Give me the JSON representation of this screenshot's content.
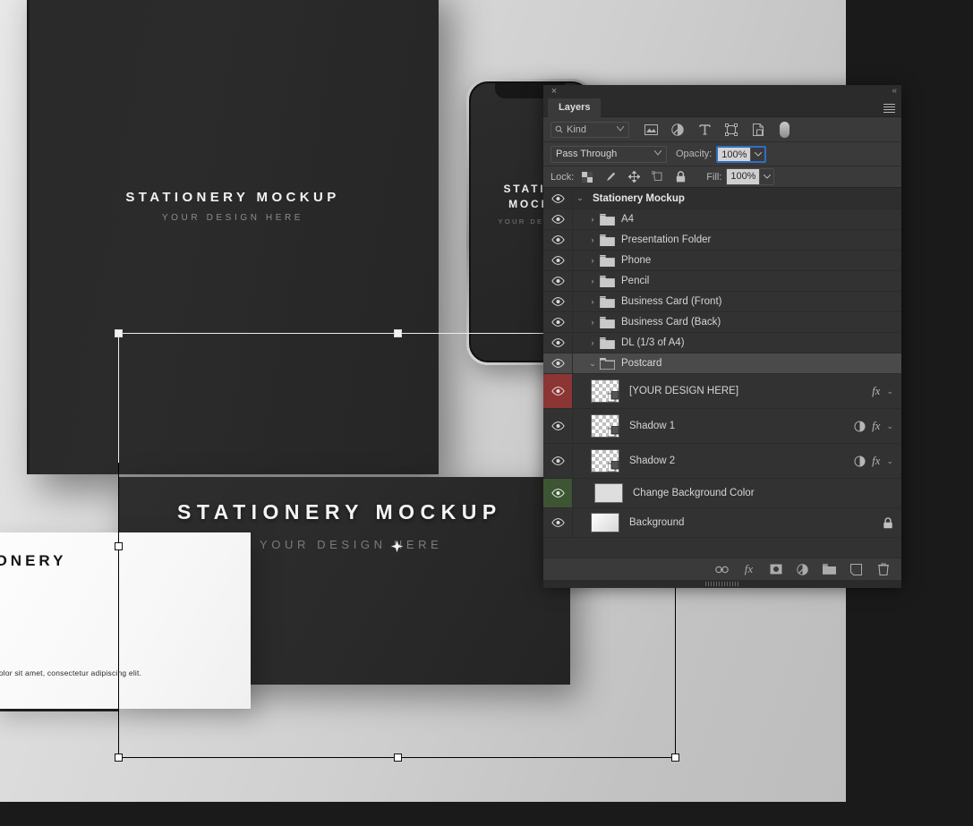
{
  "app": {
    "background_color": "#1a1a1a",
    "canvas_color": "#cfcfcf"
  },
  "canvas": {
    "a4": {
      "title": "STATIONERY MOCKUP",
      "subtitle": "YOUR DESIGN HERE"
    },
    "phone": {
      "title_line1": "STATIO",
      "title_line2": "MOCK",
      "subtitle": "YOUR DESIG"
    },
    "wide_card": {
      "title": "STATIONERY MOCKUP",
      "subtitle": "YOUR DESIGN HERE"
    },
    "white_card": {
      "title": "STATIONERY",
      "body": "Lorem ipsum dolor sit amet, consectetur adipiscing elit."
    },
    "cursor": "move-tool-cursor"
  },
  "panel": {
    "close_label": "×",
    "collapse_label": "«",
    "tab_label": "Layers",
    "menu_icon": "panel-menu-icon",
    "filter": {
      "kind_label": "Kind",
      "search_icon": "search-icon",
      "caret": "⌄",
      "icons": [
        "pixel-layer-filter-icon",
        "adjustment-layer-filter-icon",
        "type-layer-filter-icon",
        "shape-layer-filter-icon",
        "smart-object-filter-icon"
      ],
      "toggle": "filter-enable-toggle"
    },
    "blend": {
      "mode": "Pass Through",
      "opacity_label": "Opacity:",
      "opacity_value": "100%",
      "caret": "⌄"
    },
    "lock": {
      "label": "Lock:",
      "icons": [
        "lock-transparent-pixels-icon",
        "lock-image-pixels-icon",
        "lock-position-icon",
        "lock-artboard-nesting-icon",
        "lock-all-icon"
      ],
      "fill_label": "Fill:",
      "fill_value": "100%"
    },
    "layers": [
      {
        "name": "Stationery Mockup",
        "type": "group",
        "expanded": true,
        "visible": true,
        "bold": true,
        "depth": 0,
        "twisty": "⌄",
        "selected": false
      },
      {
        "name": "A4",
        "type": "group",
        "expanded": false,
        "visible": true,
        "depth": 1,
        "twisty": "›",
        "selected": false
      },
      {
        "name": "Presentation Folder",
        "type": "group",
        "expanded": false,
        "visible": true,
        "depth": 1,
        "twisty": "›",
        "selected": false
      },
      {
        "name": "Phone",
        "type": "group",
        "expanded": false,
        "visible": true,
        "depth": 1,
        "twisty": "›",
        "selected": false
      },
      {
        "name": "Pencil",
        "type": "group",
        "expanded": false,
        "visible": true,
        "depth": 1,
        "twisty": "›",
        "selected": false
      },
      {
        "name": "Business Card (Front)",
        "type": "group",
        "expanded": false,
        "visible": true,
        "depth": 1,
        "twisty": "›",
        "selected": false
      },
      {
        "name": "Business Card (Back)",
        "type": "group",
        "expanded": false,
        "visible": true,
        "depth": 1,
        "twisty": "›",
        "selected": false
      },
      {
        "name": "DL (1/3 of A4)",
        "type": "group",
        "expanded": false,
        "visible": true,
        "depth": 1,
        "twisty": "›",
        "selected": false
      },
      {
        "name": "Postcard",
        "type": "group",
        "expanded": true,
        "visible": true,
        "depth": 1,
        "twisty": "⌄",
        "selected": true
      },
      {
        "name": "[YOUR DESIGN HERE]",
        "type": "smart-object",
        "visible": true,
        "depth": 2,
        "eye_highlight": "#8c3535",
        "fx": "fx",
        "chevron": "⌄",
        "mask_icon": false,
        "selected": false
      },
      {
        "name": "Shadow 1",
        "type": "smart-object",
        "visible": true,
        "depth": 2,
        "fx": "fx",
        "chevron": "⌄",
        "mask_icon": true,
        "selected": false
      },
      {
        "name": "Shadow 2",
        "type": "smart-object",
        "visible": true,
        "depth": 2,
        "fx": "fx",
        "chevron": "⌄",
        "mask_icon": true,
        "selected": false
      },
      {
        "name": "Change Background Color",
        "type": "solid-fill",
        "visible": true,
        "depth": 1,
        "eye_highlight": "#3d5533",
        "selected": false
      },
      {
        "name": "Background",
        "type": "background",
        "visible": true,
        "depth": 1,
        "locked": true,
        "selected": false
      }
    ],
    "footer_icons": [
      "link-layers-icon",
      "add-layer-style-icon",
      "add-layer-mask-icon",
      "new-adjustment-layer-icon",
      "new-group-icon",
      "new-layer-icon",
      "delete-layer-icon"
    ]
  }
}
